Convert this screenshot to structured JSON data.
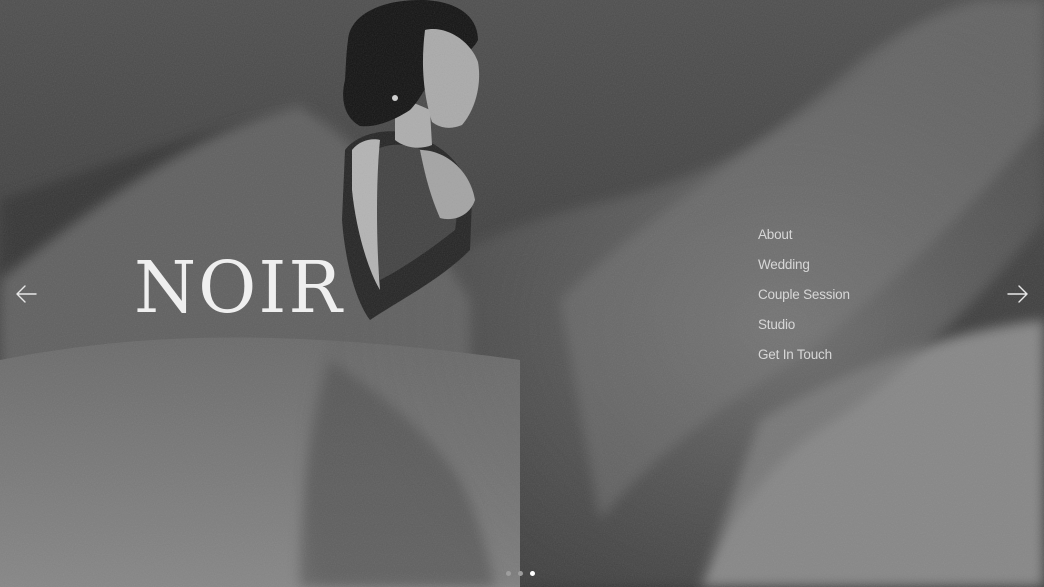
{
  "brand": {
    "title": "NOIR"
  },
  "nav": {
    "items": [
      {
        "label": "About"
      },
      {
        "label": "Wedding"
      },
      {
        "label": "Couple Session"
      },
      {
        "label": "Studio"
      },
      {
        "label": "Get In Touch"
      }
    ]
  },
  "carousel": {
    "prev_icon": "arrow-left-icon",
    "next_icon": "arrow-right-icon",
    "slide_count": 3,
    "active_slide": 3
  },
  "colors": {
    "text": "#efefef",
    "nav_text": "#d7d7d7",
    "dot_inactive": "#9d9d9d",
    "dot_active": "#ffffff"
  }
}
